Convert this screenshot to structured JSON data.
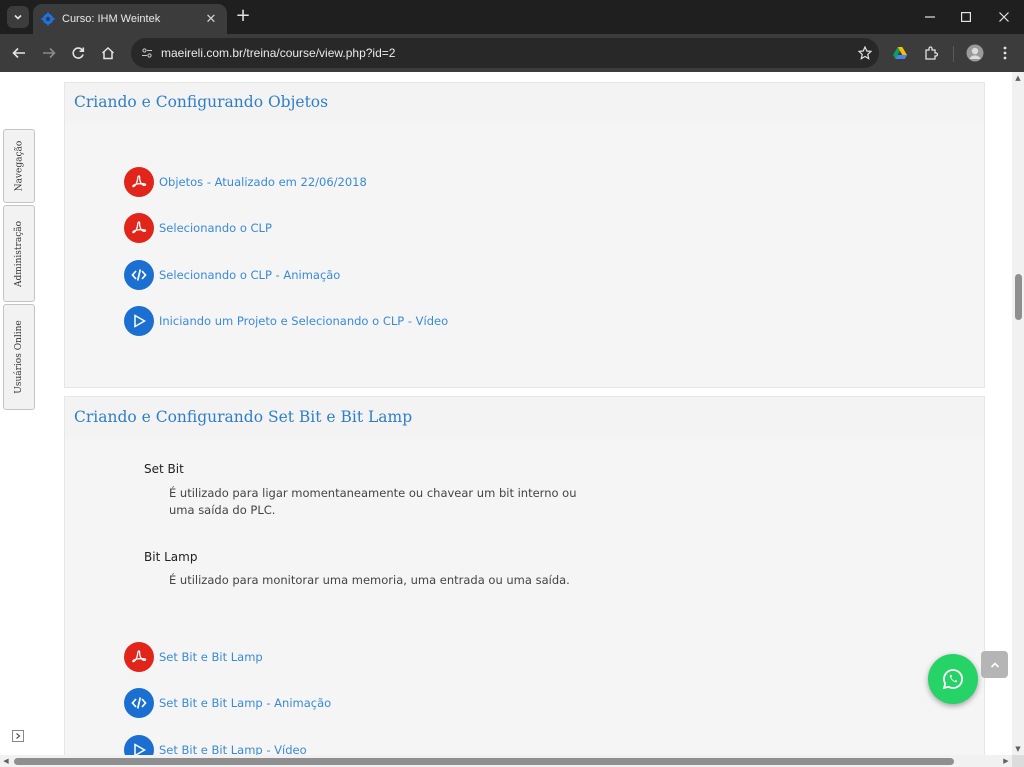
{
  "browser": {
    "tab": {
      "title": "Curso: IHM Weintek",
      "close_label": "✕"
    },
    "new_tab_label": "+",
    "url": "maeireli.com.br/treina/course/view.php?id=2",
    "colors": {
      "frame": "#1f1f1f",
      "toolbar": "#3c3c3c",
      "omnibox": "#282828"
    }
  },
  "sidebar_tabs": [
    {
      "label": "Navegação"
    },
    {
      "label": "Administração"
    },
    {
      "label": "Usuários Online"
    }
  ],
  "sections": [
    {
      "title": "Criando e Configurando Objetos",
      "activities": [
        {
          "type": "pdf",
          "icon": "pdf-icon",
          "label": "Objetos - Atualizado em 22/06/2018"
        },
        {
          "type": "pdf",
          "icon": "pdf-icon",
          "label": "Selecionando o CLP"
        },
        {
          "type": "code",
          "icon": "code-icon",
          "label": "Selecionando o CLP - Animação"
        },
        {
          "type": "video",
          "icon": "play-icon",
          "label": "Iniciando um Projeto e Selecionando o CLP - Vídeo"
        }
      ]
    },
    {
      "title": "Criando e Configurando Set Bit e Bit Lamp",
      "summary": [
        {
          "term": "Set Bit",
          "description": "É utilizado para ligar momentaneamente ou chavear um bit interno ou uma saída do PLC."
        },
        {
          "term": "Bit Lamp",
          "description": "É utilizado para monitorar uma memoria, uma entrada ou uma saída."
        }
      ],
      "activities": [
        {
          "type": "pdf",
          "icon": "pdf-icon",
          "label": "Set Bit e Bit Lamp"
        },
        {
          "type": "code",
          "icon": "code-icon",
          "label": "Set Bit e Bit Lamp - Animação"
        },
        {
          "type": "video",
          "icon": "play-icon",
          "label": "Set Bit e Bit Lamp - Vídeo"
        }
      ]
    }
  ],
  "theme": {
    "link": "#3a8ad6",
    "title": "#2f7fc8",
    "pdf": "#e1251b",
    "blue": "#1a6fd1",
    "whatsapp": "#25d366"
  }
}
